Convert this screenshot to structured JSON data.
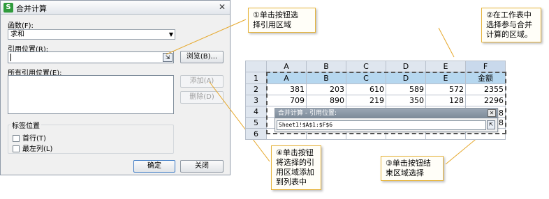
{
  "dialog": {
    "icon_glyph": "S",
    "title": "合并计算",
    "close_glyph": "✕",
    "function_label": "函数(F):",
    "function_value": "求和",
    "reference_label": "引用位置(R):",
    "browse_label": "浏览(B)...",
    "all_references_label": "所有引用位置(E):",
    "add_label": "添加(A)",
    "delete_label": "删除(D)",
    "label_position_title": "标签位置",
    "first_row_label": "首行(T)",
    "left_column_label": "最左列(L)",
    "ok_label": "确定",
    "close_label": "关闭"
  },
  "callouts": {
    "c1": [
      "①单击按钮选",
      "择引用区域"
    ],
    "c2": [
      "②在工作表中",
      "选择参与合并",
      "计算的区域。"
    ],
    "c3": [
      "③单击按钮结",
      "束区域选择"
    ],
    "c4": [
      "④单击按钮",
      "将选择的引",
      "用区域添加",
      "到列表中"
    ]
  },
  "sheet": {
    "columns": [
      "A",
      "B",
      "C",
      "D",
      "E",
      "F"
    ],
    "row_numbers": [
      "1",
      "2",
      "3",
      "4",
      "5",
      "6"
    ],
    "header_row": [
      "A",
      "B",
      "C",
      "D",
      "E",
      "金额"
    ],
    "rows": [
      [
        "381",
        "203",
        "610",
        "589",
        "572",
        "2355"
      ],
      [
        "709",
        "890",
        "219",
        "350",
        "128",
        "2296"
      ]
    ],
    "extra_right": [
      "8",
      "8"
    ]
  },
  "mini_dialog": {
    "title": "合并计算 - 引用位置:",
    "close_glyph": "✕",
    "reference_value": "Sheet1!$A$1:$F$6"
  }
}
